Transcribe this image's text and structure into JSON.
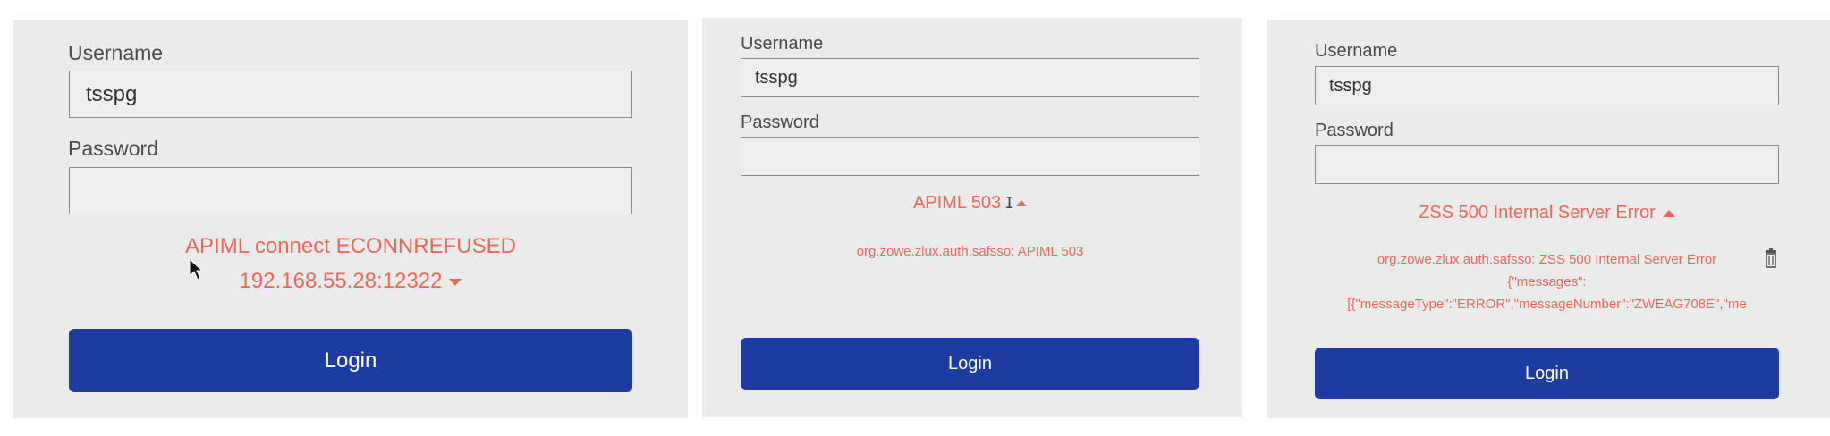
{
  "panels": [
    {
      "username_label": "Username",
      "username_value": "tsspg",
      "password_label": "Password",
      "password_value": "",
      "error_line1": "APIML connect ECONNREFUSED",
      "error_line2": "192.168.55.28:12322",
      "error_toggle_icon": "chevron-down-icon",
      "login_label": "Login"
    },
    {
      "username_label": "Username",
      "username_value": "tsspg",
      "password_label": "Password",
      "password_value": "",
      "error_title": "APIML 503",
      "error_toggle_icon": "chevron-up-icon",
      "error_detail": "org.zowe.zlux.auth.safsso: APIML 503",
      "login_label": "Login"
    },
    {
      "username_label": "Username",
      "username_value": "tsspg",
      "password_label": "Password",
      "password_value": "",
      "error_title": "ZSS 500 Internal Server Error",
      "error_toggle_icon": "chevron-up-icon",
      "error_detail_line1": "org.zowe.zlux.auth.safsso: ZSS 500 Internal Server Error",
      "error_detail_line2": "{\"messages\":",
      "error_detail_line3": "[{\"messageType\":\"ERROR\",\"messageNumber\":\"ZWEAG708E\",\"me",
      "copy_icon": "trash-icon",
      "login_label": "Login"
    }
  ],
  "colors": {
    "panel_bg": "#ebebeb",
    "error": "#e8695c",
    "button": "#1c3ca2",
    "label": "#4a4a4a"
  }
}
